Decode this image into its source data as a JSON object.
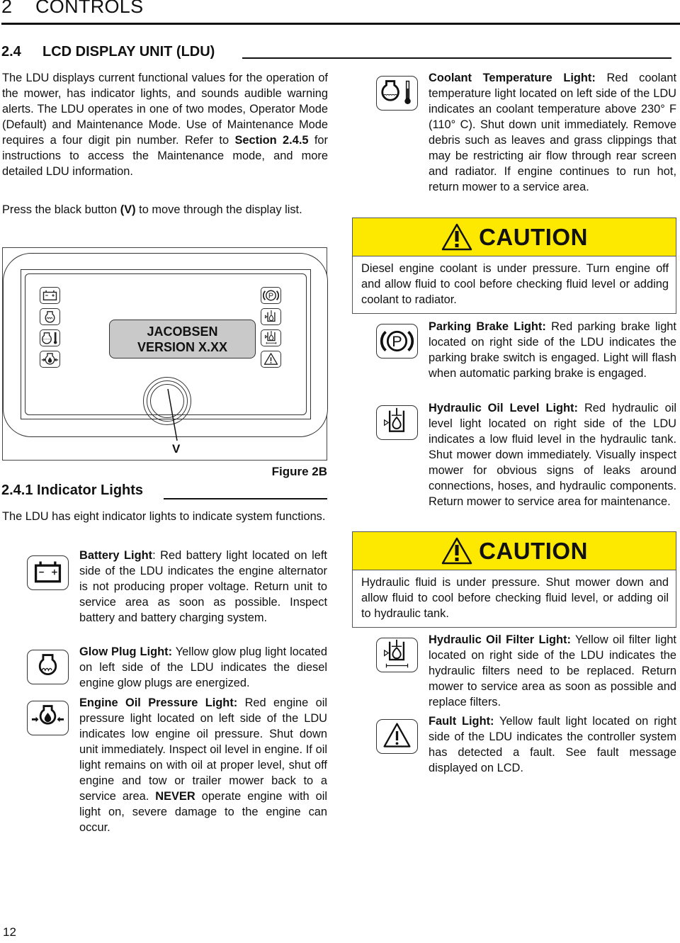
{
  "chapter": {
    "number": "2",
    "title": "CONTROLS"
  },
  "section": {
    "number": "2.4",
    "title": "LCD DISPLAY UNIT (LDU)"
  },
  "intro": {
    "paragraph1_a": "The LDU displays current functional values for the operation of the mower, has indicator lights, and sounds audible warning alerts. The LDU operates in one of two modes, Operator Mode (Default) and Maintenance Mode. Use of Maintenance Mode requires a four digit pin number. Refer to ",
    "paragraph1_bold": "Section 2.4.5",
    "paragraph1_b": " for instructions to access the Maintenance mode, and more detailed LDU information.",
    "paragraph2_a": "Press the black button ",
    "paragraph2_bold": "(V)",
    "paragraph2_b": " to move through the display list."
  },
  "figure": {
    "lcd_line1": "JACOBSEN",
    "lcd_line2": "VERSION X.XX",
    "button_label": "V",
    "caption": "Figure 2B",
    "left_icons": [
      "battery-icon",
      "glow-plug-icon",
      "coolant-temperature-icon",
      "engine-oil-pressure-icon"
    ],
    "right_icons": [
      "parking-brake-icon",
      "hydraulic-oil-level-icon",
      "hydraulic-oil-filter-icon",
      "fault-icon"
    ]
  },
  "subsection": {
    "number": "2.4.1",
    "title": "Indicator Lights",
    "intro": "The LDU has eight indicator lights to indicate system functions."
  },
  "indicators": [
    {
      "icon": "battery-icon",
      "title": "Battery Light",
      "sep": ":",
      "text": " Red battery light located on left side of the LDU indicates the engine alternator is not producing proper voltage. Return unit to service area as soon as possible. Inspect battery and battery charging system."
    },
    {
      "icon": "glow-plug-icon",
      "title": "Glow Plug Light:",
      "text": " Yellow glow plug light located on left side of the LDU indicates the diesel engine glow plugs are energized."
    },
    {
      "icon": "engine-oil-pressure-icon",
      "title": "Engine Oil Pressure Light:",
      "text_a": " Red engine oil pressure light located on left side of the LDU indicates low engine oil pressure. Shut down unit immediately. Inspect oil level in engine. If oil light remains on with oil at proper level, shut off engine and tow or trailer mower back to a service area. ",
      "text_bold": "NEVER",
      "text_b": " operate engine with oil light on, severe damage to the engine can occur."
    },
    {
      "icon": "coolant-temperature-icon",
      "title": "Coolant Temperature Light:",
      "text": " Red coolant temperature light located on left side of the LDU indicates an coolant temperature above 230° F (110° C). Shut down unit immediately. Remove debris such as leaves and grass clippings that may be restricting air flow through rear screen and radiator. If engine continues to run hot, return mower to a service area."
    },
    {
      "icon": "parking-brake-icon",
      "title": "Parking Brake Light:",
      "text": " Red parking brake light located on right side of the LDU indicates the parking brake switch is engaged. Light will flash when automatic parking brake is engaged."
    },
    {
      "icon": "hydraulic-oil-level-icon",
      "title": "Hydraulic Oil Level Light:",
      "text": " Red hydraulic oil level light located on right side of the LDU indicates a low fluid level in the hydraulic tank. Shut mower down immediately. Visually inspect mower for obvious signs of leaks around connections, hoses, and hydraulic components. Return mower to service area for maintenance."
    },
    {
      "icon": "hydraulic-oil-filter-icon",
      "title": "Hydraulic Oil Filter Light:",
      "text": " Yellow oil filter light located on right side of the LDU indicates the hydraulic filters need to be replaced. Return mower to service area as soon as possible and replace filters."
    },
    {
      "icon": "fault-icon",
      "title": "Fault Light:",
      "text": " Yellow fault light located on right side of the LDU indicates the controller system has detected a fault. See fault message displayed on LCD."
    }
  ],
  "cautions": [
    {
      "label": "CAUTION",
      "text": "Diesel engine coolant is under pressure. Turn engine off and allow fluid to cool before checking fluid level or adding coolant to radiator."
    },
    {
      "label": "CAUTION",
      "text": "Hydraulic fluid is under pressure. Shut mower down and allow fluid to cool before checking fluid level, or adding oil to hydraulic tank."
    }
  ],
  "colors": {
    "caution_yellow": "#fde900",
    "lcd_gray": "#c9c9c9"
  },
  "page_number": "12"
}
